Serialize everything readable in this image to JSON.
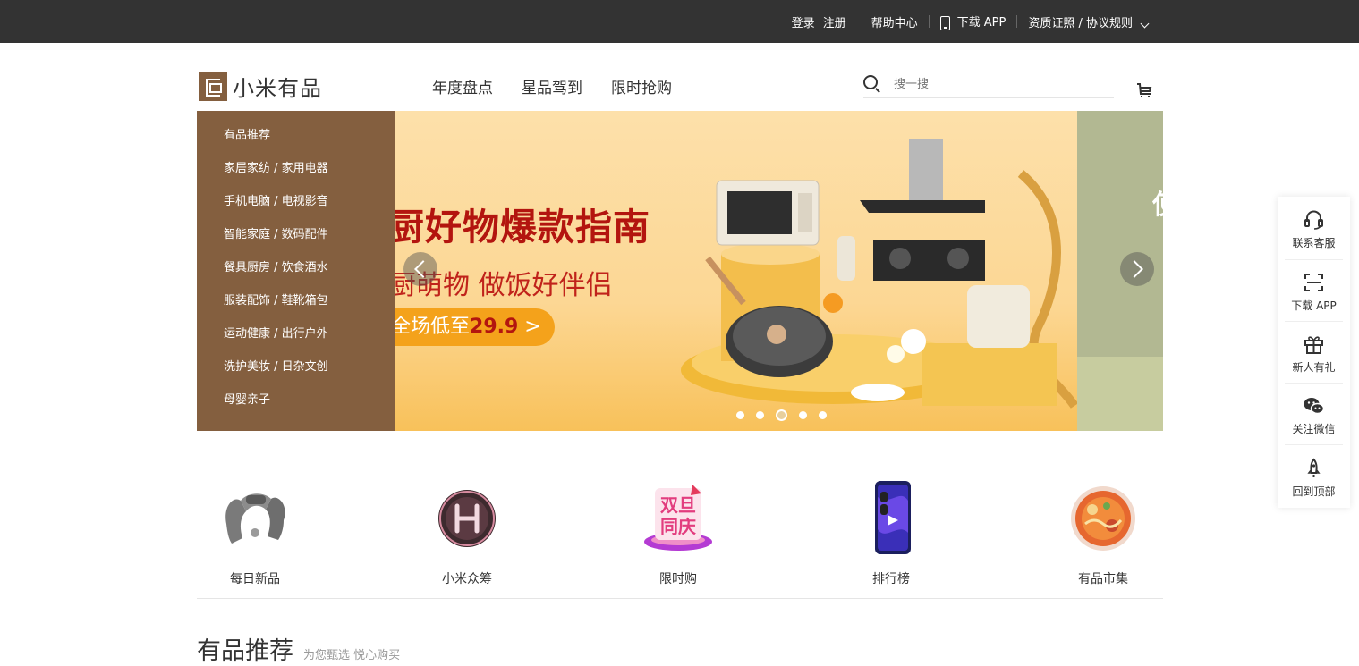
{
  "topbar": {
    "login": "登录",
    "register": "注册",
    "help": "帮助中心",
    "download_app": "下载 APP",
    "qualifications": "资质证照 / 协议规则"
  },
  "header": {
    "logo_text": "小米有品",
    "nav": [
      "年度盘点",
      "星品驾到",
      "限时抢购"
    ],
    "search_placeholder": "搜一搜"
  },
  "categories": [
    "有品推荐",
    "家居家纺 / 家用电器",
    "手机电脑 / 电视影音",
    "智能家庭 / 数码配件",
    "餐具厨房 / 饮食酒水",
    "服装配饰 / 鞋靴箱包",
    "运动健康 / 出行户外",
    "洗护美妆 / 日杂文创",
    "母婴亲子"
  ],
  "banner": {
    "headline": "厨好物爆款指南",
    "subline": "厨萌物 做饭好伴侣",
    "promo_prefix": "全场低至",
    "promo_price": "29.9",
    "promo_arrow": ">",
    "peek_text": "使",
    "slide_count": 5,
    "active_slide": 3,
    "background_color": "#fcd794",
    "accent_color": "#b3150f"
  },
  "quick_entries": [
    {
      "label": "每日新品",
      "icon": "massager-icon"
    },
    {
      "label": "小米众筹",
      "icon": "crowdfunding-icon"
    },
    {
      "label": "限时购",
      "icon": "double-festival-icon"
    },
    {
      "label": "排行榜",
      "icon": "phone-ranking-icon"
    },
    {
      "label": "有品市集",
      "icon": "noodle-bowl-icon"
    }
  ],
  "sidebar": [
    {
      "label": "联系客服",
      "icon": "headset-icon"
    },
    {
      "label": "下载 APP",
      "icon": "scan-icon"
    },
    {
      "label": "新人有礼",
      "icon": "gift-icon"
    },
    {
      "label": "关注微信",
      "icon": "wechat-icon"
    },
    {
      "label": "回到顶部",
      "icon": "rocket-icon"
    }
  ],
  "section": {
    "title": "有品推荐",
    "subtitle": "为您甄选 悦心购买"
  },
  "colors": {
    "brand": "#845f3f",
    "topbar": "#333333"
  }
}
